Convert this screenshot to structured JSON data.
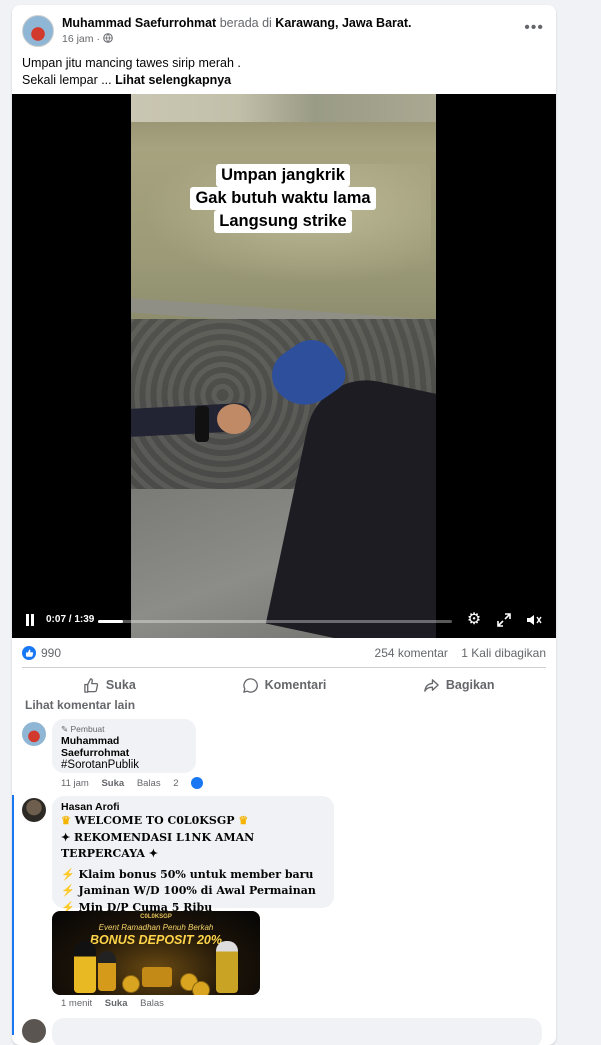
{
  "post": {
    "author": "Muhammad Saefurrohmat",
    "location_prefix": "berada di",
    "location": "Karawang, Jawa Barat.",
    "time": "16 jam",
    "separator": "·",
    "text_line1": "Umpan jitu mancing tawes sirip merah .",
    "text_line2": "Sekali lempar ...",
    "see_more": "Lihat selengkapnya"
  },
  "video": {
    "caption": [
      "Umpan jangkrik",
      "Gak butuh waktu lama",
      "Langsung strike"
    ],
    "time": "0:07 / 1:39",
    "progress": 0.07
  },
  "stats": {
    "likes": "990",
    "comments": "254 komentar",
    "shares": "1 Kali dibagikan"
  },
  "actions": {
    "like": "Suka",
    "comment": "Komentari",
    "share": "Bagikan"
  },
  "more_comments": "Lihat komentar lain",
  "comments": [
    {
      "badge": "Pembuat",
      "name": "Muhammad Saefurrohmat",
      "text": "#SorotanPublik",
      "time": "11 jam",
      "like": "Suka",
      "reply": "Balas",
      "reactions": "2"
    },
    {
      "name": "Hasan Arofi",
      "lines": [
        "WELCOME TO C0L0KSGP",
        "✦ REKOMENDASI L1NK AMAN TERPERCAYA ✦",
        "Klaim bonus 50% untuk member baru",
        "Jaminan W/D 100% di Awal Permainan",
        "Min D/P Cuma 5 Ribu"
      ],
      "banner_logo": "C0L0KSGP",
      "banner_subtitle": "Event Ramadhan Penuh Berkah",
      "banner_title": "BONUS DEPOSIT 20%",
      "time": "1 menit",
      "like": "Suka",
      "reply": "Balas"
    }
  ],
  "colors": {
    "accent": "#1877f2",
    "card": "#ffffff",
    "bg": "#f0f2f5",
    "muted": "#65676b"
  }
}
